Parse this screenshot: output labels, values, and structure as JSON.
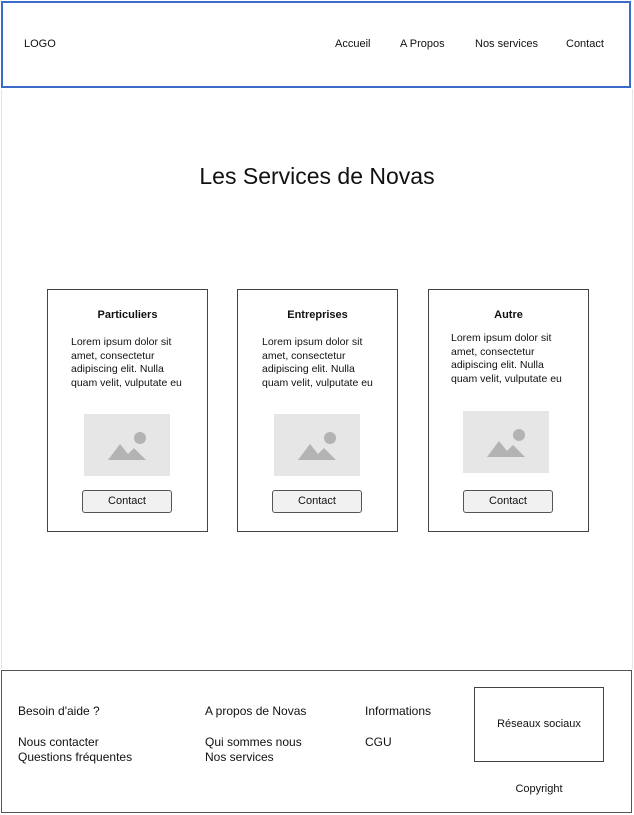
{
  "header": {
    "logo": "LOGO",
    "nav": [
      "Accueil",
      "A Propos",
      "Nos services",
      "Contact"
    ]
  },
  "main": {
    "title": "Les Services de Novas",
    "cards": [
      {
        "title": "Particuliers",
        "text": "Lorem ipsum dolor sit amet, consectetur adipiscing elit. Nulla quam velit, vulputate eu",
        "button": "Contact",
        "image_icon": "image-placeholder-icon"
      },
      {
        "title": "Entreprises",
        "text": "Lorem ipsum dolor sit amet, consectetur adipiscing elit. Nulla quam velit, vulputate eu",
        "button": "Contact",
        "image_icon": "image-placeholder-icon"
      },
      {
        "title": "Autre",
        "text": "Lorem ipsum dolor sit amet, consectetur adipiscing elit. Nulla quam velit, vulputate eu",
        "button": "Contact",
        "image_icon": "image-placeholder-icon"
      }
    ]
  },
  "footer": {
    "col1": {
      "title": "Besoin d'aide ?",
      "links": [
        "Nous contacter",
        "Questions fréquentes"
      ]
    },
    "col2": {
      "title": "A propos de Novas",
      "links": [
        "Qui sommes nous",
        "Nos services"
      ]
    },
    "col3": {
      "title": "Informations",
      "links": [
        "CGU"
      ]
    },
    "social": "Réseaux sociaux",
    "copyright": "Copyright"
  },
  "colors": {
    "header_border": "#3b6cc9",
    "placeholder_bg": "#e6e6e6",
    "placeholder_icon": "#b3b3b3"
  }
}
